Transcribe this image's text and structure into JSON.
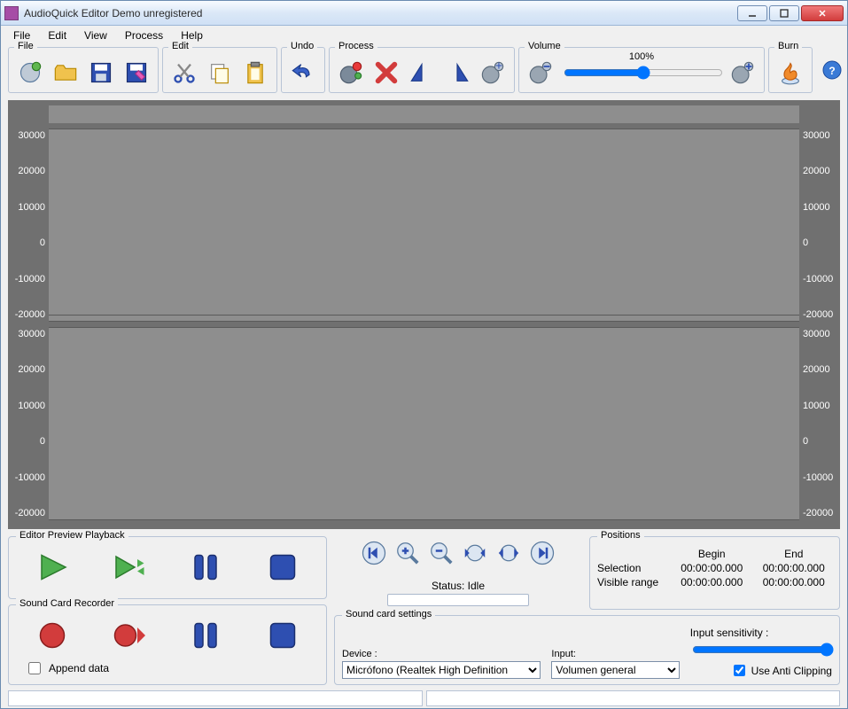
{
  "window": {
    "title": "AudioQuick Editor Demo unregistered"
  },
  "menubar": [
    "File",
    "Edit",
    "View",
    "Process",
    "Help"
  ],
  "toolbar": {
    "file_legend": "File",
    "edit_legend": "Edit",
    "undo_legend": "Undo",
    "process_legend": "Process",
    "volume_legend": "Volume",
    "burn_legend": "Burn",
    "volume_value": "100%"
  },
  "waveform": {
    "axis_ticks": [
      "30000",
      "20000",
      "10000",
      "0",
      "-10000",
      "-20000"
    ]
  },
  "playback": {
    "legend": "Editor Preview Playback"
  },
  "recorder": {
    "legend": "Sound Card Recorder",
    "append_label": "Append data"
  },
  "status": {
    "label": "Status: Idle"
  },
  "positions": {
    "legend": "Positions",
    "begin_hdr": "Begin",
    "end_hdr": "End",
    "selection_lbl": "Selection",
    "visible_lbl": "Visible range",
    "sel_begin": "00:00:00.000",
    "sel_end": "00:00:00.000",
    "vis_begin": "00:00:00.000",
    "vis_end": "00:00:00.000"
  },
  "soundcard": {
    "legend": "Sound card settings",
    "device_lbl": "Device :",
    "device_val": "Micrófono (Realtek High Definition",
    "input_lbl": "Input:",
    "input_val": "Volumen general",
    "sens_lbl": "Input sensitivity :",
    "clipping_lbl": "Use Anti Clipping"
  }
}
